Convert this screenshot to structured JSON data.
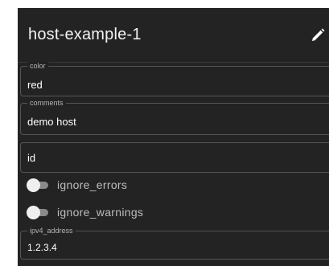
{
  "header": {
    "title": "host-example-1",
    "edit_icon": "pencil-icon"
  },
  "fields": {
    "color": {
      "label": "color",
      "value": "red"
    },
    "comments": {
      "label": "comments",
      "value": "demo host"
    },
    "id": {
      "label": "",
      "placeholder": "id",
      "value": ""
    },
    "ipv4_address": {
      "label": "ipv4_address",
      "value": "1.2.3.4"
    }
  },
  "toggles": {
    "ignore_errors": {
      "label": "ignore_errors",
      "checked": false
    },
    "ignore_warnings": {
      "label": "ignore_warnings",
      "checked": false
    }
  },
  "colors": {
    "panel_background": "#232323",
    "border": "#555555",
    "text": "#ffffff",
    "muted_text": "#b5b5b5",
    "toggle_track": "#8a8a8a",
    "toggle_thumb": "#efefef"
  }
}
